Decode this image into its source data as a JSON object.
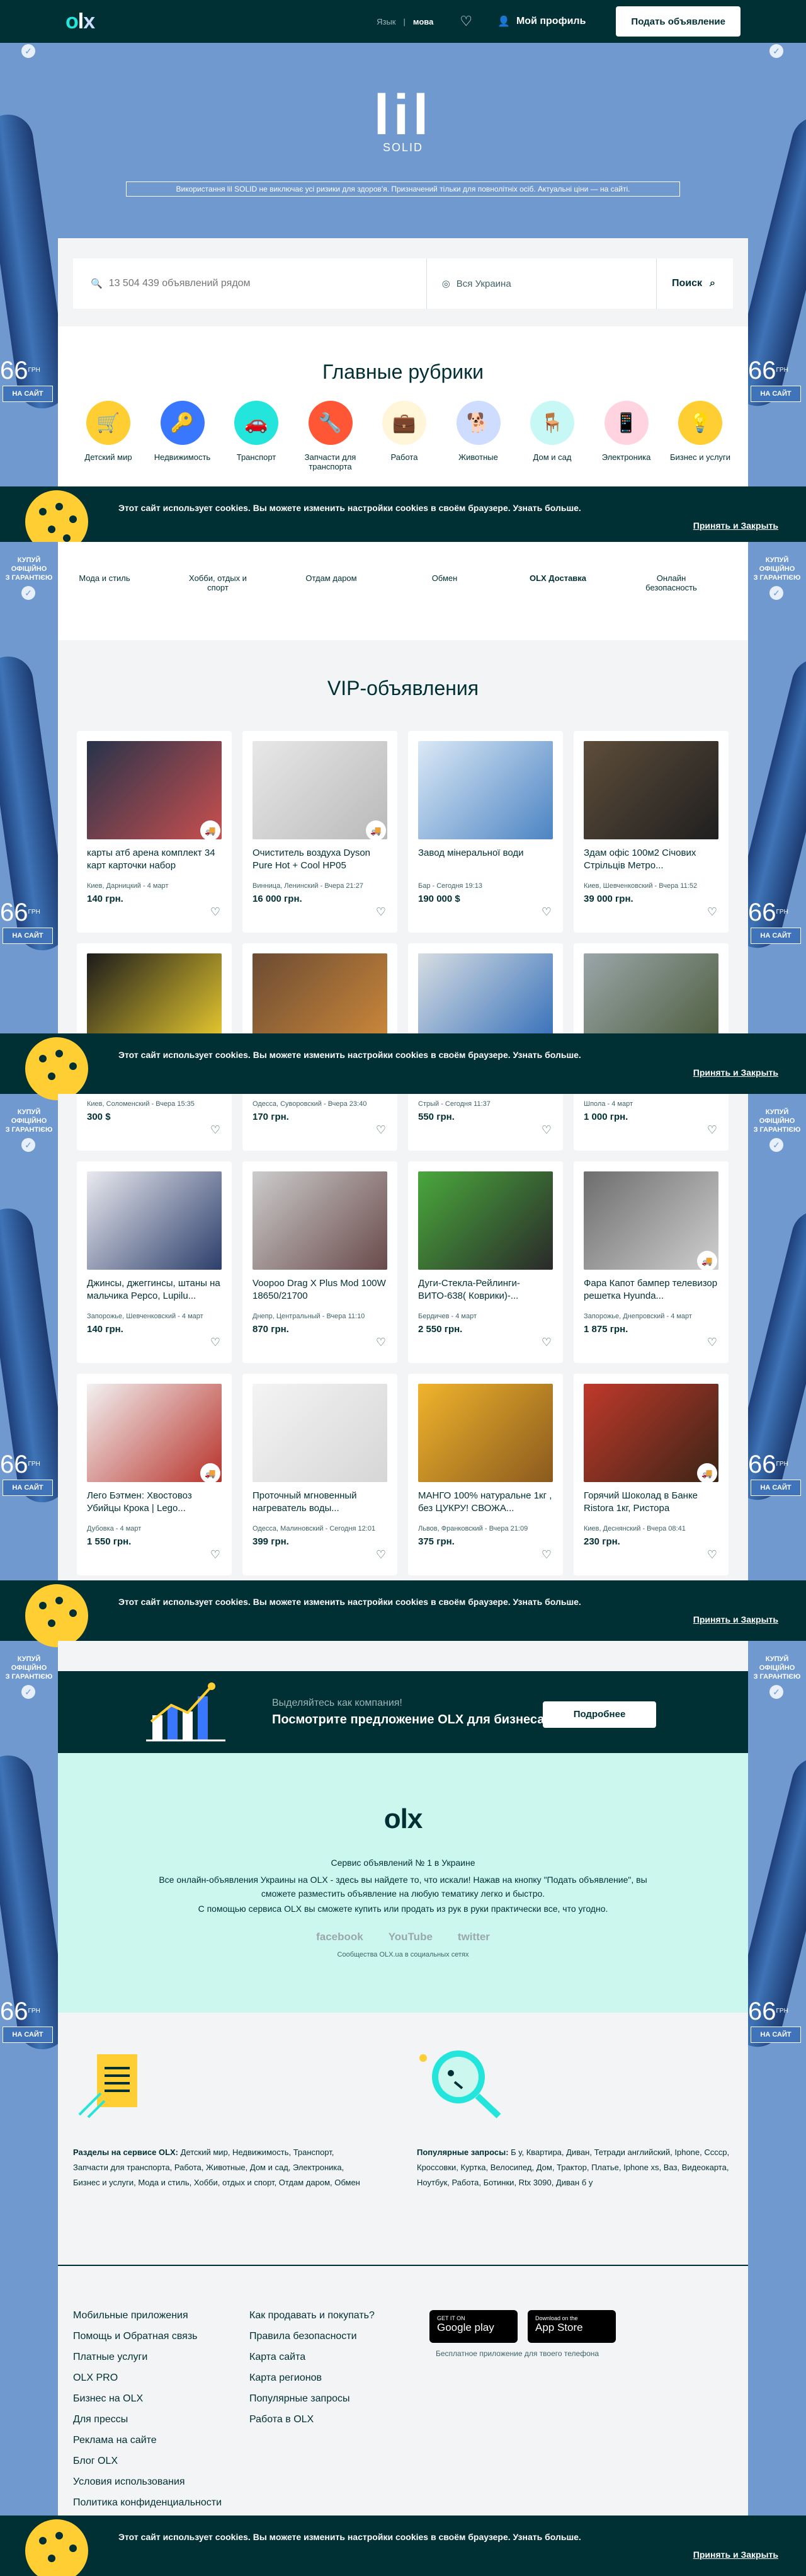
{
  "header": {
    "logo": [
      "o",
      "l",
      "x"
    ],
    "lang_ua": "Язык",
    "lang_ru": "мова",
    "favorites_icon": "heart-icon",
    "profile": "Мой профиль",
    "post_ad": "Подать объявление"
  },
  "ad": {
    "side_text": "КУПУЙ\nОФІЦІЙНО\nЗ ГАРАНТІЄЮ",
    "price": "66",
    "currency": "ГРН",
    "buy": "НА САЙТ",
    "brand": "lil",
    "brand_sub": "SOLID",
    "warning": "Використання lil SOLID не виключає усі ризики для здоров'я. Призначений тільки для повнолітніх осіб. Актуальні ціни — на сайті."
  },
  "search": {
    "placeholder": "13 504 439 объявлений рядом",
    "location": "Вся Украина",
    "button": "Поиск"
  },
  "categories": {
    "title": "Главные рубрики",
    "row1": [
      {
        "label": "Детский мир",
        "color": "#ffce32",
        "icon": "stroller"
      },
      {
        "label": "Недвижимость",
        "color": "#3a77ff",
        "icon": "key"
      },
      {
        "label": "Транспорт",
        "color": "#23e5db",
        "icon": "car"
      },
      {
        "label": "Запчасти для транспорта",
        "color": "#ff5636",
        "icon": "wrench"
      },
      {
        "label": "Работа",
        "color": "#fff6d9",
        "icon": "briefcase"
      },
      {
        "label": "Животные",
        "color": "#ceddff",
        "icon": "dog"
      },
      {
        "label": "Дом и сад",
        "color": "#c8f8f6",
        "icon": "chair"
      },
      {
        "label": "Электроника",
        "color": "#ffce32",
        "icon": "phone"
      },
      {
        "label": "Бизнес и услуги",
        "color": "#ffce32",
        "icon": "lamp"
      }
    ],
    "row2": [
      "Мода и стиль",
      "Хобби, отдых и спорт",
      "Отдам даром",
      "Обмен",
      "OLX Доставка",
      "Онлайн безопасность"
    ]
  },
  "cookie": {
    "message": "Этот сайт использует cookies. Вы можете изменить настройки cookies в своём браузере.",
    "more": "Узнать больше.",
    "accept": "Принять и Закрыть"
  },
  "vip": {
    "title": "VIP-объявления",
    "items": [
      {
        "title": "карты атб арена комплект 34 карт карточки набор",
        "loc": "Киев, Дарницкий - 4 март",
        "price": "140 грн.",
        "c1": "#27334a",
        "c2": "#c94f4f",
        "truck": true
      },
      {
        "title": "Очиститель воздуха Dyson Pure Hot + Cool HP05",
        "loc": "Винница, Ленинский - Вчера 21:27",
        "price": "16 000 грн.",
        "c1": "#e8e8e8",
        "c2": "#b9b9b9",
        "truck": true
      },
      {
        "title": "Завод мінеральної води",
        "loc": "Бар - Сегодня 19:13",
        "price": "190 000 $",
        "c1": "#dbe9f6",
        "c2": "#4c84c3",
        "truck": false
      },
      {
        "title": "Здам офіс 100м2 Січових Стрільців Метро...",
        "loc": "Киев, Шевченковский - Вчера 11:52",
        "price": "39 000 грн.",
        "c1": "#5e4d3a",
        "c2": "#1f1f1f",
        "truck": false
      },
      {
        "title": "",
        "loc": "Киев, Соломенский - Вчера 15:35",
        "price": "300 $",
        "c1": "#1b1b1b",
        "c2": "#f2d230",
        "truck": false
      },
      {
        "title": "",
        "loc": "Одесса, Суворовский - Вчера 23:40",
        "price": "170 грн.",
        "c1": "#6b4b33",
        "c2": "#d18b3a",
        "truck": false
      },
      {
        "title": "",
        "loc": "Стрый - Сегодня 11:37",
        "price": "550 грн.",
        "c1": "#d7dde2",
        "c2": "#2e6bb8",
        "truck": false
      },
      {
        "title": "",
        "loc": "Шпола - 4 март",
        "price": "1 000 грн.",
        "c1": "#9aa6a9",
        "c2": "#4a5a3a",
        "truck": false
      },
      {
        "title": "Джинсы, джеггинсы, штаны на мальчика Pepco, Lupilu...",
        "loc": "Запорожье, Шевченковский - 4 март",
        "price": "140 грн.",
        "c1": "#e9e9ef",
        "c2": "#2c3e6b",
        "truck": false
      },
      {
        "title": "Voopoo Drag X Plus Mod 100W 18650/21700",
        "loc": "Днепр, Центральный - Вчера 11:10",
        "price": "870 грн.",
        "c1": "#cccccc",
        "c2": "#6a4a4a",
        "truck": false
      },
      {
        "title": "Дуги-Стекла-Рейлинги-ВИТО-638( Коврики)-...",
        "loc": "Бердичев - 4 март",
        "price": "2 550 грн.",
        "c1": "#49a83c",
        "c2": "#2a2a2a",
        "truck": false
      },
      {
        "title": "Фара Капот бампер телевизор решетка Hyunda...",
        "loc": "Запорожье, Днепровский - 4 март",
        "price": "1 875 грн.",
        "c1": "#6d6d6d",
        "c2": "#cfcfcf",
        "truck": true
      },
      {
        "title": "Лего Бэтмен: Хвостовоз Убийцы Крока | Lego...",
        "loc": "Дубовка - 4 март",
        "price": "1 550 грн.",
        "c1": "#f2f2f2",
        "c2": "#b8322a",
        "truck": true
      },
      {
        "title": "Проточный мгновенный нагреватель воды...",
        "loc": "Одесса, Малиновский - Сегодня 12:01",
        "price": "399 грн.",
        "c1": "#f4f4f4",
        "c2": "#d6d6d6",
        "truck": false
      },
      {
        "title": "МАНГО 100% натуральне 1кг , без ЦУКРУ! СВОЖА...",
        "loc": "Львов, Франковский - Вчера 21:09",
        "price": "375 грн.",
        "c1": "#f0b42c",
        "c2": "#8a5a1e",
        "truck": false
      },
      {
        "title": "Горячий Шоколад в Банке Ristora 1кг, Ристора",
        "loc": "Киев, Деснянский - Вчера 08:41",
        "price": "230 грн.",
        "c1": "#c0392b",
        "c2": "#3b2416",
        "truck": true
      }
    ]
  },
  "business": {
    "line1": "Выделяйтесь как компания!",
    "line2": "Посмотрите предложение OLX для бизнеса",
    "button": "Подробнее"
  },
  "about": {
    "subtitle": "Сервис объявлений № 1 в Украине",
    "text1": "Все онлайн-объявления Украины на OLX - здесь вы найдете то, что искали! Нажав на кнопку \"Подать объявление\", вы сможете разместить объявление на любую тематику легко и быстро.",
    "text2": "С помощью сервиса OLX вы сможете купить или продать из рук в руки практически все, что угодно.",
    "socials": [
      "facebook",
      "YouTube",
      "twitter"
    ],
    "socials_caption": "Сообщества OLX.ua в социальных сетях"
  },
  "seo": {
    "sections_label": "Разделы на сервисе OLX:",
    "sections": "Детский мир, Недвижимость, Транспорт, Запчасти для транспорта, Работа, Животные, Дом и сад, Электроника, Бизнес и услуги, Мода и стиль, Хобби, отдых и спорт, Отдам даром, Обмен",
    "popular_label": "Популярные запросы:",
    "popular": "Б у, Квартира, Диван, Тетради английский, Iphone, Сссср, Кроссовки, Куртка, Велосипед, Дом, Трактор, Платье, Iphone xs, Ваз, Видеокарта, Ноутбук, Работа, Ботинки, Rtx 3090, Диван б у"
  },
  "footer": {
    "col1": [
      "Мобильные приложения",
      "Помощь и Обратная связь",
      "Платные услуги",
      "OLX PRO",
      "Бизнес на OLX",
      "Для прессы",
      "Реклама на сайте",
      "Блог OLX",
      "Условия использования",
      "Политика конфиденциальности"
    ],
    "col2": [
      "Как продавать и покупать?",
      "Правила безопасности",
      "Карта сайта",
      "Карта регионов",
      "Популярные запросы",
      "Работа в OLX"
    ],
    "gp_small": "GET IT ON",
    "gp": "Google play",
    "as_small": "Download on the",
    "as": "App Store",
    "apps_caption": "Бесплатное приложение для твоего телефона"
  }
}
